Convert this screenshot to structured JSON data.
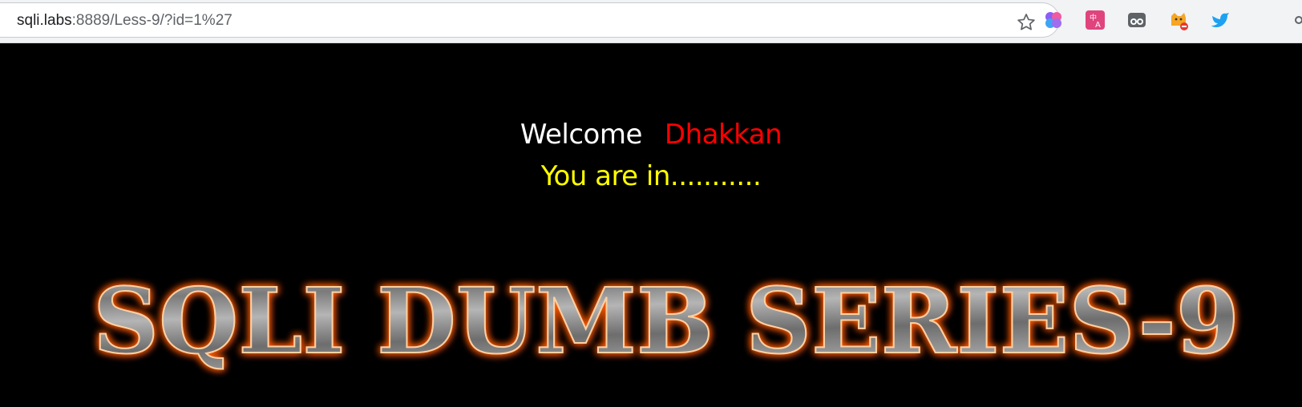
{
  "browser": {
    "url_host": "sqli.labs",
    "url_rest": ":8889/Less-9/?id=1%27",
    "extensions": [
      "brain-extension-icon",
      "translate-extension-icon",
      "ghost-extension-icon",
      "cat-blocked-extension-icon",
      "bird-extension-icon"
    ]
  },
  "page": {
    "welcome": "Welcome",
    "name": "Dhakkan",
    "message": "You are in...........",
    "banner": "SQLI DUMB SERIES-9"
  },
  "colors": {
    "background": "#000000",
    "welcome": "#ffffff",
    "name": "#ff0000",
    "message": "#ffff00",
    "banner_glow": "#ff5a00"
  }
}
